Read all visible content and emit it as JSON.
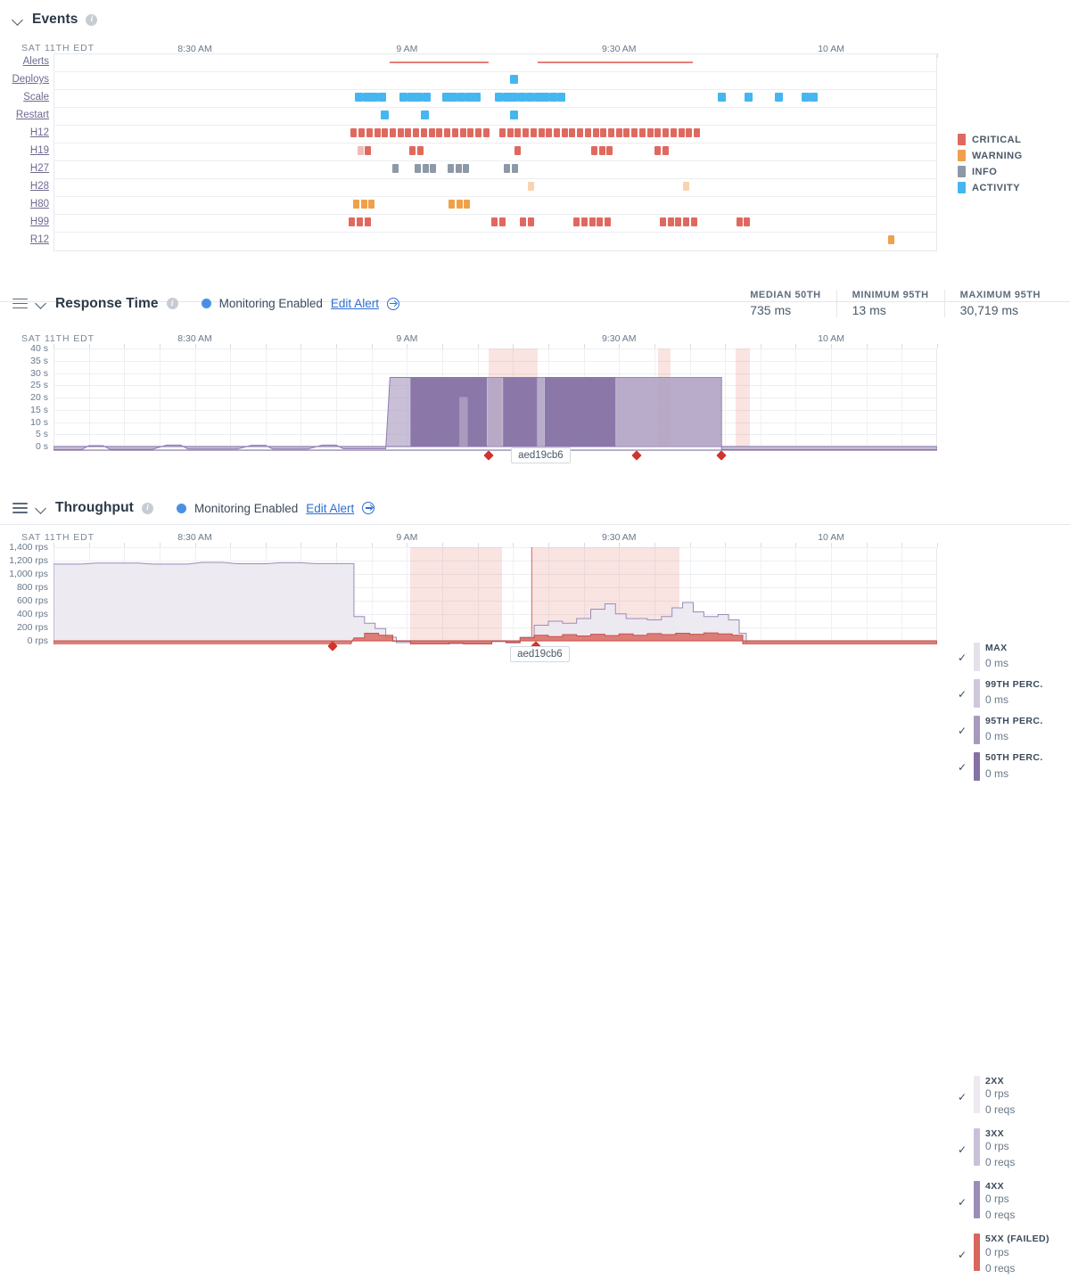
{
  "events": {
    "title": "Events",
    "info_icon": "info-icon",
    "day_label": "SAT 11TH EDT",
    "x_ticks": [
      "8:30 AM",
      "9 AM",
      "9:30 AM",
      "10 AM"
    ],
    "rows": [
      "Alerts",
      "Deploys",
      "Scale",
      "Restart",
      "H12",
      "H19",
      "H27",
      "H28",
      "H80",
      "H99",
      "R12"
    ],
    "legend": [
      {
        "label": "CRITICAL",
        "color": "#e0695f"
      },
      {
        "label": "WARNING",
        "color": "#f0a04b"
      },
      {
        "label": "INFO",
        "color": "#8d99a6"
      },
      {
        "label": "ACTIVITY",
        "color": "#45b6f0"
      }
    ]
  },
  "response_time": {
    "title": "Response Time",
    "info_icon": "info-icon",
    "monitoring_label": "Monitoring Enabled",
    "edit_alert_label": "Edit Alert",
    "day_label": "SAT 11TH EDT",
    "stats": [
      {
        "key": "MEDIAN 50TH",
        "value": "735 ms"
      },
      {
        "key": "MINIMUM 95TH",
        "value": "13 ms"
      },
      {
        "key": "MAXIMUM 95TH",
        "value": "30,719 ms"
      }
    ],
    "tooltip": "aed19cb6",
    "legend": [
      {
        "label": "MAX",
        "value": "0 ms",
        "color": "#e4e1ea",
        "checked": "✓"
      },
      {
        "label": "99TH PERC.",
        "value": "0 ms",
        "color": "#cfc8db",
        "checked": "✓"
      },
      {
        "label": "95TH PERC.",
        "value": "0 ms",
        "color": "#a899bf",
        "checked": "✓"
      },
      {
        "label": "50TH PERC.",
        "value": "0 ms",
        "color": "#8572a5",
        "checked": "✓"
      }
    ]
  },
  "throughput": {
    "title": "Throughput",
    "info_icon": "info-icon",
    "monitoring_label": "Monitoring Enabled",
    "edit_alert_label": "Edit Alert",
    "day_label": "SAT 11TH EDT",
    "tooltip": "aed19cb6",
    "legend": [
      {
        "label": "2XX",
        "rps": "0 rps",
        "reqs": "0 reqs",
        "color": "#ece9f1",
        "checked": "✓"
      },
      {
        "label": "3XX",
        "rps": "0 rps",
        "reqs": "0 reqs",
        "color": "#c9c1d9",
        "checked": "✓"
      },
      {
        "label": "4XX",
        "rps": "0 rps",
        "reqs": "0 reqs",
        "color": "#9b8cb8",
        "checked": "✓"
      },
      {
        "label": "5XX (FAILED)",
        "rps": "0 rps",
        "reqs": "0 reqs",
        "color": "#d9655c",
        "checked": "✓"
      }
    ]
  },
  "chart_data": [
    {
      "type": "heatmap",
      "name": "events-timeline",
      "title": "Events",
      "xlabel": "",
      "ylabel": "",
      "x_tick_labels": [
        "8:30 AM",
        "9 AM",
        "9:30 AM",
        "10 AM"
      ],
      "x_tick_positions_min": [
        30,
        60,
        90,
        120
      ],
      "xlim_min": [
        10,
        135
      ],
      "categories": [
        "Alerts",
        "Deploys",
        "Scale",
        "Restart",
        "H12",
        "H19",
        "H27",
        "H28",
        "H80",
        "H99",
        "R12"
      ],
      "severity_colors": {
        "critical": "#e0695f",
        "warning": "#f0a04b",
        "info": "#8d99a6",
        "activity": "#45b6f0"
      },
      "series": [
        {
          "name": "Alerts",
          "kind": "span",
          "severity": "critical",
          "spans": [
            [
              57.5,
              71.5
            ],
            [
              78.5,
              100.5
            ]
          ]
        },
        {
          "name": "Deploys",
          "kind": "marks",
          "severity": "activity",
          "marks": [
            75.2
          ]
        },
        {
          "name": "Scale",
          "kind": "marks",
          "severity": "activity",
          "marks": [
            53.2,
            54.3,
            55.4,
            56.5,
            59.5,
            60.6,
            61.7,
            62.8,
            65.5,
            66.6,
            67.7,
            68.8,
            69.9,
            73,
            74.1,
            75.2,
            76.3,
            77.4,
            78.5,
            79.6,
            80.7,
            81.8,
            104.5,
            108.3,
            112.6,
            116.4,
            117.5
          ]
        },
        {
          "name": "Restart",
          "kind": "marks",
          "severity": "activity",
          "marks": [
            56.8,
            62.5,
            75.2
          ]
        },
        {
          "name": "H12",
          "kind": "marks",
          "severity": "critical",
          "marks": [
            52.5,
            53.6,
            54.7,
            55.8,
            56.9,
            58,
            59.1,
            60.2,
            61.3,
            62.4,
            63.5,
            64.6,
            65.7,
            66.8,
            67.9,
            69,
            70.1,
            71.2,
            73.5,
            74.6,
            75.7,
            76.8,
            77.9,
            79,
            80.1,
            81.2,
            82.3,
            83.4,
            84.5,
            85.6,
            86.7,
            87.8,
            88.9,
            90,
            91.1,
            92.2,
            93.3,
            94.4,
            95.5,
            96.6,
            97.7,
            98.8,
            99.9,
            101
          ]
        },
        {
          "name": "H19",
          "kind": "marks",
          "severity": "critical",
          "marks": [
            53.4,
            54.5,
            60.8,
            61.9,
            75.6,
            86.5,
            87.6,
            88.7,
            95.5,
            96.6
          ],
          "faded_marks": [
            53.4
          ]
        },
        {
          "name": "H27",
          "kind": "marks",
          "severity": "info",
          "marks": [
            58.4,
            61.5,
            62.6,
            63.7,
            66.2,
            67.3,
            68.4,
            74.2,
            75.3
          ]
        },
        {
          "name": "H28",
          "kind": "marks",
          "severity": "warning",
          "marks": [
            77.5,
            99.5
          ],
          "opacity": 0.45
        },
        {
          "name": "H80",
          "kind": "marks",
          "severity": "warning",
          "marks": [
            52.8,
            53.9,
            55,
            66.3,
            67.4,
            68.5
          ]
        },
        {
          "name": "H99",
          "kind": "marks",
          "severity": "critical",
          "marks": [
            52.2,
            53.3,
            54.4,
            72.4,
            73.5,
            76.4,
            77.5,
            84,
            85.1,
            86.2,
            87.3,
            88.4,
            96.2,
            97.3,
            98.4,
            99.5,
            100.6,
            107,
            108.1
          ]
        },
        {
          "name": "R12",
          "kind": "marks",
          "severity": "warning",
          "marks": [
            128.5
          ]
        }
      ]
    },
    {
      "type": "area",
      "name": "response-time",
      "title": "Response Time",
      "xlabel": "",
      "ylabel": "seconds",
      "x_tick_labels": [
        "8:30 AM",
        "9 AM",
        "9:30 AM",
        "10 AM"
      ],
      "y_tick_labels": [
        "40 s",
        "35 s",
        "30 s",
        "25 s",
        "20 s",
        "15 s",
        "10 s",
        "5 s",
        "0 s"
      ],
      "ylim": [
        0,
        40
      ],
      "grid": true,
      "legend_position": "right",
      "annotations": [
        {
          "text": "aed19cb6",
          "type": "tooltip"
        }
      ],
      "incident_bands_min": [
        [
          71.5,
          78.5
        ],
        [
          95.5,
          97.3
        ],
        [
          106.5,
          108.5
        ]
      ],
      "series": [
        {
          "name": "MAX",
          "color": "#e4e1ea",
          "value": "0 ms"
        },
        {
          "name": "99TH PERC.",
          "color": "#cfc8db",
          "value": "0 ms"
        },
        {
          "name": "95TH PERC.",
          "color": "#a899bf",
          "value": "0 ms"
        },
        {
          "name": "50TH PERC.",
          "color": "#8572a5",
          "value": "0 ms"
        }
      ],
      "notes": "Baseline near 0-2 s until ~9:00 AM, then saturates at ~30 s plateau until ~9:45 AM, then returns to 0."
    },
    {
      "type": "area",
      "name": "throughput",
      "title": "Throughput",
      "xlabel": "",
      "ylabel": "rps",
      "x_tick_labels": [
        "8:30 AM",
        "9 AM",
        "9:30 AM",
        "10 AM"
      ],
      "y_tick_labels": [
        "1,400 rps",
        "1,200 rps",
        "1,000 rps",
        "800 rps",
        "600 rps",
        "400 rps",
        "200 rps",
        "0 rps"
      ],
      "ylim": [
        0,
        1400
      ],
      "grid": true,
      "legend_position": "right",
      "annotations": [
        {
          "text": "aed19cb6",
          "type": "tooltip"
        }
      ],
      "incident_bands_min": [
        [
          60.5,
          73.5
        ],
        [
          77.5,
          98.5
        ]
      ],
      "series": [
        {
          "name": "2XX",
          "color": "#ece9f1",
          "rps": "0 rps",
          "reqs": "0 reqs"
        },
        {
          "name": "3XX",
          "color": "#c9c1d9",
          "rps": "0 rps",
          "reqs": "0 reqs"
        },
        {
          "name": "4XX",
          "color": "#9b8cb8",
          "rps": "0 rps",
          "reqs": "0 reqs"
        },
        {
          "name": "5XX (FAILED)",
          "color": "#d9655c",
          "rps": "0 rps",
          "reqs": "0 reqs"
        }
      ],
      "notes": "~1,200 rps steady until ~8:58 AM, collapses to near 0, partial recovery to ~300-600 rps with sustained 5XX errors, drops to 0 after ~9:45 AM."
    }
  ]
}
